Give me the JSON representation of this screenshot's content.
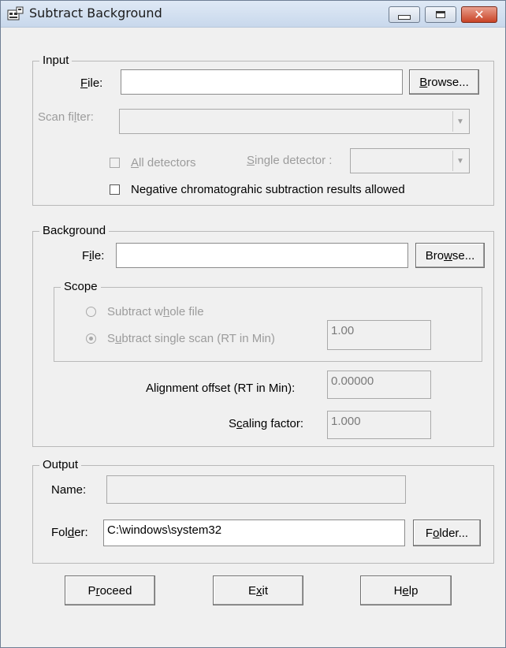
{
  "window": {
    "title": "Subtract Background",
    "close_glyph": "✕"
  },
  "input": {
    "group_label": "Input",
    "file_label_u": "F",
    "file_label_rest": "ile:",
    "file_value": "",
    "browse_u": "B",
    "browse_rest": "rowse...",
    "scan_filter_pre": "Scan fi",
    "scan_filter_u": "l",
    "scan_filter_post": "ter:",
    "scan_filter_value": "",
    "all_detectors_u": "A",
    "all_detectors_rest": "ll detectors",
    "all_detectors_checked": false,
    "single_detector_u": "S",
    "single_detector_rest": "ingle detector :",
    "single_detector_value": "",
    "negative_label": "Negative chromatograhic subtraction results allowed",
    "negative_checked": false
  },
  "background": {
    "group_label": "Background",
    "file_pre": "F",
    "file_u": "i",
    "file_post": "le:",
    "file_value": "",
    "browse_pre": "Bro",
    "browse_u": "w",
    "browse_post": "se...",
    "scope": {
      "group_label": "Scope",
      "whole_pre": "Subtract w",
      "whole_u": "h",
      "whole_post": "ole file",
      "single_pre": "S",
      "single_u": "u",
      "single_post": "btract single scan (RT in Min)",
      "selected": "single",
      "rt_value": "1.00"
    },
    "alignment_pre": "Alignment offset (RT in Min):",
    "alignment_value": "0.00000",
    "scaling_pre": "S",
    "scaling_u": "c",
    "scaling_post": "aling factor:",
    "scaling_value": "1.000"
  },
  "output": {
    "group_label": "Output",
    "name_label": "Name:",
    "name_value": "",
    "folder_pre": "Fol",
    "folder_u": "d",
    "folder_post": "er:",
    "folder_value": "C:\\windows\\system32",
    "folder_btn_pre": "F",
    "folder_btn_u": "o",
    "folder_btn_post": "lder..."
  },
  "buttons": {
    "proceed_pre": "P",
    "proceed_u": "r",
    "proceed_post": "oceed",
    "exit_pre": "E",
    "exit_u": "x",
    "exit_post": "it",
    "help_pre": "H",
    "help_u": "e",
    "help_post": "lp"
  }
}
